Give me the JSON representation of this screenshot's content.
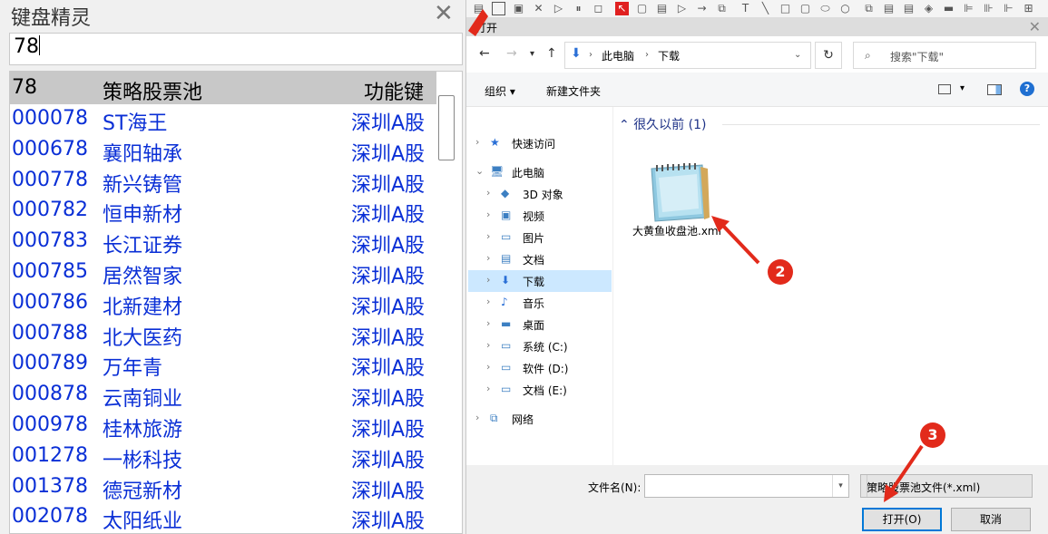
{
  "keyboard_sprite": {
    "title": "键盘精灵",
    "close_glyph": "✕",
    "input_value": "78",
    "header": {
      "code": "78",
      "name": "策略股票池",
      "key": "功能键"
    },
    "rows": [
      {
        "code": "000078",
        "name": "ST海王",
        "market": "深圳A股"
      },
      {
        "code": "000678",
        "name": "襄阳轴承",
        "market": "深圳A股"
      },
      {
        "code": "000778",
        "name": "新兴铸管",
        "market": "深圳A股"
      },
      {
        "code": "000782",
        "name": "恒申新材",
        "market": "深圳A股"
      },
      {
        "code": "000783",
        "name": "长江证券",
        "market": "深圳A股"
      },
      {
        "code": "000785",
        "name": "居然智家",
        "market": "深圳A股"
      },
      {
        "code": "000786",
        "name": "北新建材",
        "market": "深圳A股"
      },
      {
        "code": "000788",
        "name": "北大医药",
        "market": "深圳A股"
      },
      {
        "code": "000789",
        "name": "万年青",
        "market": "深圳A股"
      },
      {
        "code": "000878",
        "name": "云南铜业",
        "market": "深圳A股"
      },
      {
        "code": "000978",
        "name": "桂林旅游",
        "market": "深圳A股"
      },
      {
        "code": "001278",
        "name": "一彬科技",
        "market": "深圳A股"
      },
      {
        "code": "001378",
        "name": "德冠新材",
        "market": "深圳A股"
      },
      {
        "code": "002078",
        "name": "太阳纸业",
        "market": "深圳A股"
      }
    ]
  },
  "dialog": {
    "title": "打开",
    "address": {
      "part1": "此电脑",
      "part2": "下载",
      "search_placeholder": "搜索\"下载\""
    },
    "commands": {
      "organize": "组织",
      "new_folder": "新建文件夹"
    },
    "nav_items": [
      {
        "label": "快速访问",
        "icon": "star-icon"
      },
      {
        "label": "此电脑",
        "icon": "computer-icon"
      },
      {
        "label": "3D 对象",
        "icon": "cube-icon"
      },
      {
        "label": "视频",
        "icon": "video-icon"
      },
      {
        "label": "图片",
        "icon": "picture-icon"
      },
      {
        "label": "文档",
        "icon": "document-icon"
      },
      {
        "label": "下载",
        "icon": "download-icon",
        "selected": true
      },
      {
        "label": "音乐",
        "icon": "music-icon"
      },
      {
        "label": "桌面",
        "icon": "desktop-icon"
      },
      {
        "label": "系统 (C:)",
        "icon": "drive-icon"
      },
      {
        "label": "软件 (D:)",
        "icon": "drive-icon"
      },
      {
        "label": "文档 (E:)",
        "icon": "drive-icon"
      },
      {
        "label": "网络",
        "icon": "network-icon"
      }
    ],
    "group_label": "很久以前 (1)",
    "file": {
      "name": "大黄鱼收盘池.xml",
      "icon": "notepad-icon"
    },
    "filename_label": "文件名(N):",
    "filename_value": "",
    "filter_value": "策略股票池文件(*.xml)",
    "open_button": "打开(O)",
    "cancel_button": "取消"
  },
  "markers": {
    "m2": "2",
    "m3": "3"
  },
  "colors": {
    "accent": "#0078d7",
    "marker": "#e22a1b",
    "stock_text": "#0a2fd6"
  }
}
